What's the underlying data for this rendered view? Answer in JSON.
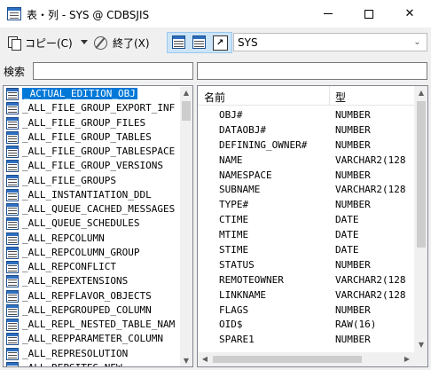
{
  "window": {
    "title": "表・列 - SYS @ CDBSJIS",
    "icons": {
      "app": "table-icon",
      "minimize": "minimize-icon",
      "maximize": "maximize-icon",
      "close": "close-icon"
    }
  },
  "toolbar": {
    "copy_label": "コピー(C)",
    "end_label": "終了(X)",
    "view_icons": [
      "table-view-icon",
      "table-detail-view-icon",
      "shortcut-arrow-icon"
    ],
    "schema_value": "SYS"
  },
  "search": {
    "label": "検索",
    "value": "",
    "value2": ""
  },
  "tables": {
    "selected_index": 0,
    "items": [
      "_ACTUAL_EDITION_OBJ",
      "_ALL_FILE_GROUP_EXPORT_INF",
      "_ALL_FILE_GROUP_FILES",
      "_ALL_FILE_GROUP_TABLES",
      "_ALL_FILE_GROUP_TABLESPACE",
      "_ALL_FILE_GROUP_VERSIONS",
      "_ALL_FILE_GROUPS",
      "_ALL_INSTANTIATION_DDL",
      "_ALL_QUEUE_CACHED_MESSAGES",
      "_ALL_QUEUE_SCHEDULES",
      "_ALL_REPCOLUMN",
      "_ALL_REPCOLUMN_GROUP",
      "_ALL_REPCONFLICT",
      "_ALL_REPEXTENSIONS",
      "_ALL_REPFLAVOR_OBJECTS",
      "_ALL_REPGROUPED_COLUMN",
      "_ALL_REPL_NESTED_TABLE_NAM",
      "_ALL_REPPARAMETER_COLUMN",
      "_ALL_REPRESOLUTION",
      "_ALL_REPSITES_NEW"
    ]
  },
  "columns": {
    "header_name": "名前",
    "header_type": "型",
    "rows": [
      {
        "name": "OBJ#",
        "type": "NUMBER"
      },
      {
        "name": "DATAOBJ#",
        "type": "NUMBER"
      },
      {
        "name": "DEFINING_OWNER#",
        "type": "NUMBER"
      },
      {
        "name": "NAME",
        "type": "VARCHAR2(128"
      },
      {
        "name": "NAMESPACE",
        "type": "NUMBER"
      },
      {
        "name": "SUBNAME",
        "type": "VARCHAR2(128"
      },
      {
        "name": "TYPE#",
        "type": "NUMBER"
      },
      {
        "name": "CTIME",
        "type": "DATE"
      },
      {
        "name": "MTIME",
        "type": "DATE"
      },
      {
        "name": "STIME",
        "type": "DATE"
      },
      {
        "name": "STATUS",
        "type": "NUMBER"
      },
      {
        "name": "REMOTEOWNER",
        "type": "VARCHAR2(128"
      },
      {
        "name": "LINKNAME",
        "type": "VARCHAR2(128"
      },
      {
        "name": "FLAGS",
        "type": "NUMBER"
      },
      {
        "name": "OID$",
        "type": "RAW(16)"
      },
      {
        "name": "SPARE1",
        "type": "NUMBER"
      }
    ]
  }
}
